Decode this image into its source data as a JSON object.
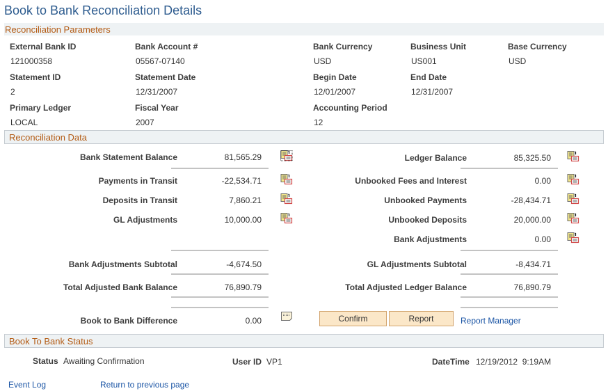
{
  "page": {
    "title": "Book to Bank Reconciliation Details"
  },
  "parameters": {
    "header": "Reconciliation Parameters",
    "fields": {
      "external_bank_id": {
        "label": "External Bank ID",
        "value": "121000358"
      },
      "bank_account": {
        "label": "Bank Account #",
        "value": "05567-07140"
      },
      "bank_currency": {
        "label": "Bank Currency",
        "value": "USD"
      },
      "business_unit": {
        "label": "Business Unit",
        "value": "US001"
      },
      "base_currency": {
        "label": "Base Currency",
        "value": "USD"
      },
      "statement_id": {
        "label": "Statement ID",
        "value": "2"
      },
      "statement_date": {
        "label": "Statement Date",
        "value": "12/31/2007"
      },
      "begin_date": {
        "label": "Begin Date",
        "value": "12/01/2007"
      },
      "end_date": {
        "label": "End Date",
        "value": "12/31/2007"
      },
      "primary_ledger": {
        "label": "Primary Ledger",
        "value": "LOCAL"
      },
      "fiscal_year": {
        "label": "Fiscal Year",
        "value": "2007"
      },
      "accounting_period": {
        "label": "Accounting Period",
        "value": "12"
      }
    }
  },
  "recon": {
    "header": "Reconciliation Data",
    "bank": {
      "statement_balance": {
        "label": "Bank Statement Balance",
        "value": "81,565.29",
        "icon": "drilldown-details-icon"
      },
      "payments_in_transit": {
        "label": "Payments in Transit",
        "value": "-22,534.71",
        "icon": "drilldown-details-icon"
      },
      "deposits_in_transit": {
        "label": "Deposits in Transit",
        "value": "7,860.21",
        "icon": "drilldown-details-icon"
      },
      "gl_adjustments": {
        "label": "GL Adjustments",
        "value": "10,000.00",
        "icon": "drilldown-details-icon"
      },
      "adjustments_subtotal": {
        "label": "Bank Adjustments Subtotal",
        "value": "-4,674.50"
      },
      "total_adjusted": {
        "label": "Total Adjusted Bank Balance",
        "value": "76,890.79"
      },
      "difference": {
        "label": "Book to Bank Difference",
        "value": "0.00",
        "icon": "comment-icon"
      }
    },
    "ledger": {
      "balance": {
        "label": "Ledger Balance",
        "value": "85,325.50",
        "icon": "drilldown-details-icon"
      },
      "unbooked_fees": {
        "label": "Unbooked Fees and Interest",
        "value": "0.00",
        "icon": "drilldown-details-icon"
      },
      "unbooked_payments": {
        "label": "Unbooked Payments",
        "value": "-28,434.71",
        "icon": "drilldown-details-icon"
      },
      "unbooked_deposits": {
        "label": "Unbooked Deposits",
        "value": "20,000.00",
        "icon": "drilldown-details-icon"
      },
      "bank_adjustments": {
        "label": "Bank Adjustments",
        "value": "0.00",
        "icon": "drilldown-details-icon"
      },
      "adjustments_subtotal": {
        "label": "GL Adjustments Subtotal",
        "value": "-8,434.71"
      },
      "total_adjusted": {
        "label": "Total Adjusted Ledger Balance",
        "value": "76,890.79"
      }
    },
    "actions": {
      "confirm": "Confirm",
      "report": "Report",
      "report_manager": "Report Manager"
    }
  },
  "status_section": {
    "header": "Book To Bank Status",
    "status": {
      "label": "Status",
      "value": "Awaiting Confirmation"
    },
    "user_id": {
      "label": "User ID",
      "value": "VP1"
    },
    "datetime": {
      "label": "DateTime",
      "value": "12/19/2012  9:19AM"
    }
  },
  "footer": {
    "event_log": "Event Log",
    "return": "Return to previous page"
  },
  "colors": {
    "title": "#2e5c8f",
    "section_header_text": "#b35b14",
    "section_header_bg": "#eef2f4",
    "link": "#1b55a5",
    "button_bg": "#fbe7c8",
    "button_border": "#d2a36c"
  }
}
